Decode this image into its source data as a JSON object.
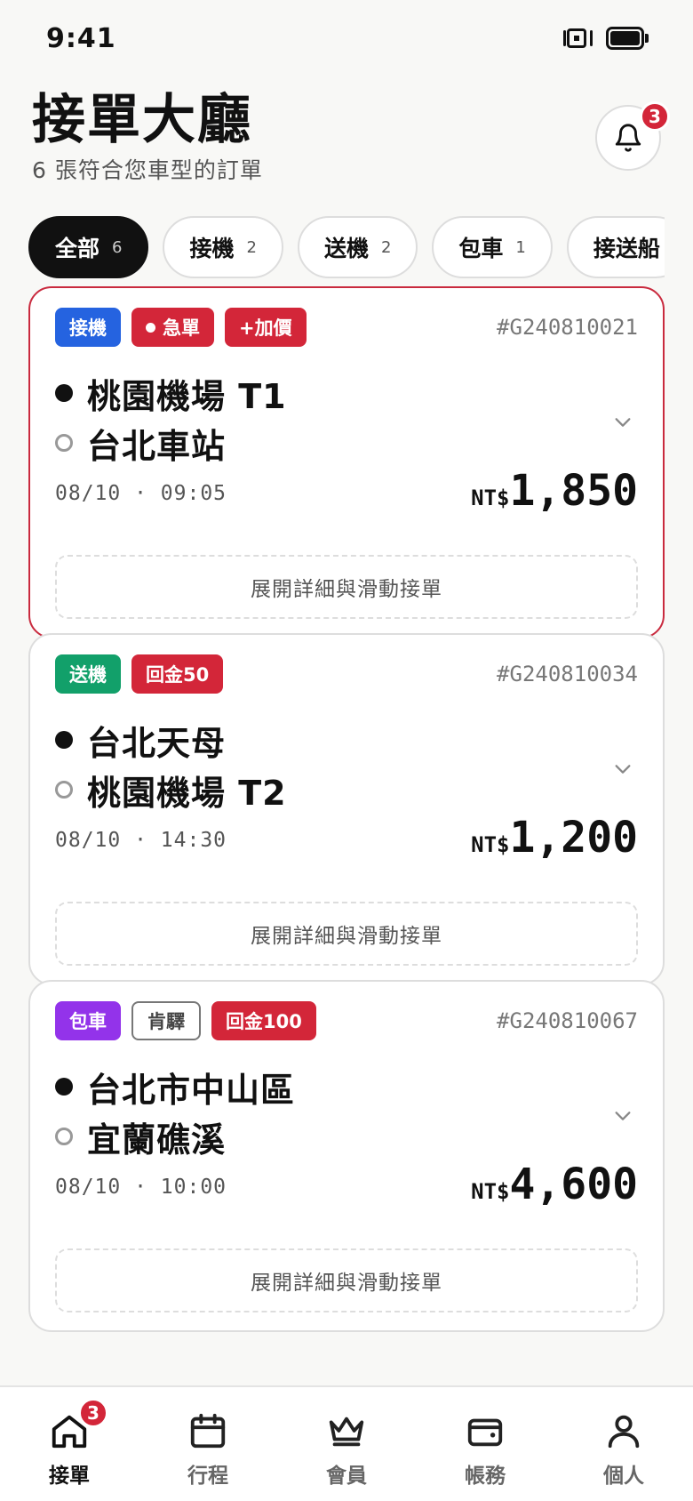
{
  "status_bar": {
    "time": "9:41"
  },
  "header": {
    "title": "接單大廳",
    "subtitle": "6 張符合您車型的訂單",
    "notification_count": "3"
  },
  "filters": [
    {
      "label": "全部",
      "count": "6",
      "active": true
    },
    {
      "label": "接機",
      "count": "2",
      "active": false
    },
    {
      "label": "送機",
      "count": "2",
      "active": false
    },
    {
      "label": "包車",
      "count": "1",
      "active": false
    },
    {
      "label": "接送船",
      "count": "",
      "active": false
    }
  ],
  "orders": [
    {
      "tags": [
        {
          "label": "接機",
          "color": "#2563e0",
          "style": "solid"
        },
        {
          "label": "急單",
          "color": "#d32639",
          "style": "solid",
          "dot": true
        },
        {
          "label": "+加價",
          "color": "#d32639",
          "style": "solid"
        }
      ],
      "id": "#G240810021",
      "from": "桃園機場 T1",
      "to": "台北車站",
      "datetime": "08/10 · 09:05",
      "currency": "NT$",
      "amount": "1,850",
      "urgent": true,
      "action": "展開詳細與滑動接單"
    },
    {
      "tags": [
        {
          "label": "送機",
          "color": "#12a06a",
          "style": "solid"
        },
        {
          "label": "回金50",
          "color": "#d32639",
          "style": "solid"
        }
      ],
      "id": "#G240810034",
      "from": "台北天母",
      "to": "桃園機場 T2",
      "datetime": "08/10 · 14:30",
      "currency": "NT$",
      "amount": "1,200",
      "urgent": false,
      "action": "展開詳細與滑動接單"
    },
    {
      "tags": [
        {
          "label": "包車",
          "color": "#9333ea",
          "style": "solid"
        },
        {
          "label": "肯驛",
          "color": "#777777",
          "style": "outline"
        },
        {
          "label": "回金100",
          "color": "#d32639",
          "style": "solid"
        }
      ],
      "id": "#G240810067",
      "from": "台北市中山區",
      "to": "宜蘭礁溪",
      "datetime": "08/10 · 10:00",
      "currency": "NT$",
      "amount": "4,600",
      "urgent": false,
      "action": "展開詳細與滑動接單"
    }
  ],
  "bottom_nav": [
    {
      "label": "接單",
      "icon": "home-icon",
      "active": true,
      "badge": "3"
    },
    {
      "label": "行程",
      "icon": "calendar-icon",
      "active": false
    },
    {
      "label": "會員",
      "icon": "crown-icon",
      "active": false
    },
    {
      "label": "帳務",
      "icon": "wallet-icon",
      "active": false
    },
    {
      "label": "個人",
      "icon": "user-icon",
      "active": false
    }
  ]
}
